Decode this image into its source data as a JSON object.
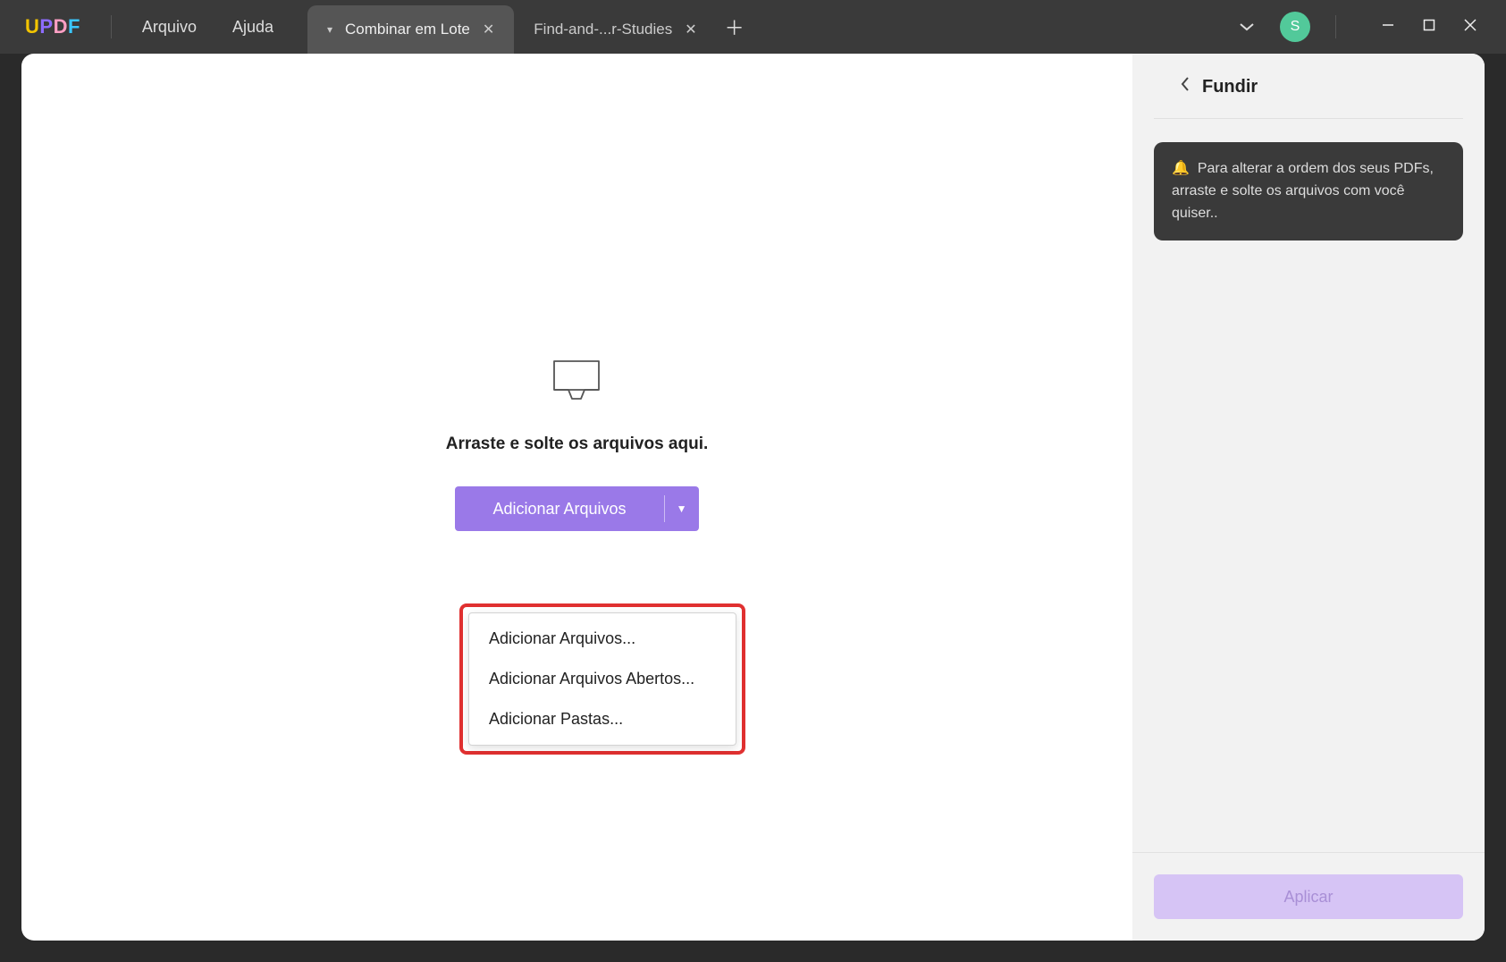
{
  "app": {
    "brand": "UPDF"
  },
  "menu": {
    "file": "Arquivo",
    "help": "Ajuda"
  },
  "tabs": {
    "active": "Combinar em Lote",
    "inactive": "Find-and-...r-Studies"
  },
  "avatar": {
    "initial": "S"
  },
  "canvas": {
    "drop_instruction": "Arraste e solte os arquivos aqui.",
    "add_button": "Adicionar Arquivos",
    "dropdown": {
      "item1": "Adicionar Arquivos...",
      "item2": "Adicionar Arquivos Abertos...",
      "item3": "Adicionar Pastas..."
    }
  },
  "sidebar": {
    "title": "Fundir",
    "tip": "Para alterar a ordem dos seus PDFs, arraste e solte os arquivos com você quiser..",
    "apply": "Aplicar"
  }
}
